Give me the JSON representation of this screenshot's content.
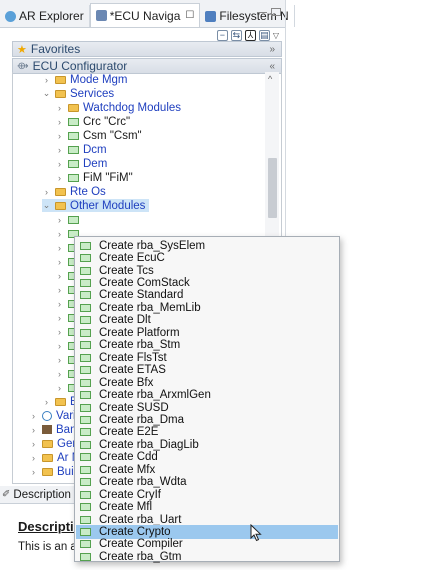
{
  "tabs": [
    {
      "label": "AR Explorer",
      "active": false,
      "icon": "ar-explorer-icon"
    },
    {
      "label": "*ECU Naviga",
      "active": true,
      "icon": "ecu-navigator-icon"
    },
    {
      "label": "Filesystem N",
      "active": false,
      "icon": "filesystem-icon"
    }
  ],
  "favorites_label": "Favorites",
  "ecu_configurator_label": "ECU Configurator",
  "tree": {
    "mode_mgm": "Mode Mgm",
    "services": "Services",
    "watchdog_modules": "Watchdog Modules",
    "crc": "Crc \"Crc\"",
    "csm": "Csm \"Csm\"",
    "dcm": "Dcm",
    "dem": "Dem",
    "fim": "FiM \"FiM\"",
    "rte_os": "Rte Os",
    "other_modules": "Other Modules",
    "ec_partial": "Ec",
    "varia_partial": "Varia",
    "bam_partial": "Bam",
    "gene_partial": "Gene",
    "ar_m_partial": "Ar M",
    "build_partial": "Buil"
  },
  "description": {
    "tab_label": "Description",
    "title": "Description",
    "body": "This is an abs"
  },
  "context_menu": {
    "items": [
      "Create rba_SysElem",
      "Create EcuC",
      "Create Tcs",
      "Create ComStack",
      "Create Standard",
      "Create rba_MemLib",
      "Create Dlt",
      "Create Platform",
      "Create rba_Stm",
      "Create FlsTst",
      "Create ETAS",
      "Create Bfx",
      "Create rba_ArxmlGen",
      "Create SUSD",
      "Create rba_Dma",
      "Create E2E",
      "Create rba_DiagLib",
      "Create Cdd",
      "Create Mfx",
      "Create rba_Wdta",
      "Create CryIf",
      "Create Mfl",
      "Create rba_Uart",
      "Create Crypto",
      "Create Compiler",
      "Create rba_Gtm"
    ],
    "selected_index": 23
  },
  "colors": {
    "selection": "#9bc8ee",
    "link_blue": "#1f3fbf"
  }
}
